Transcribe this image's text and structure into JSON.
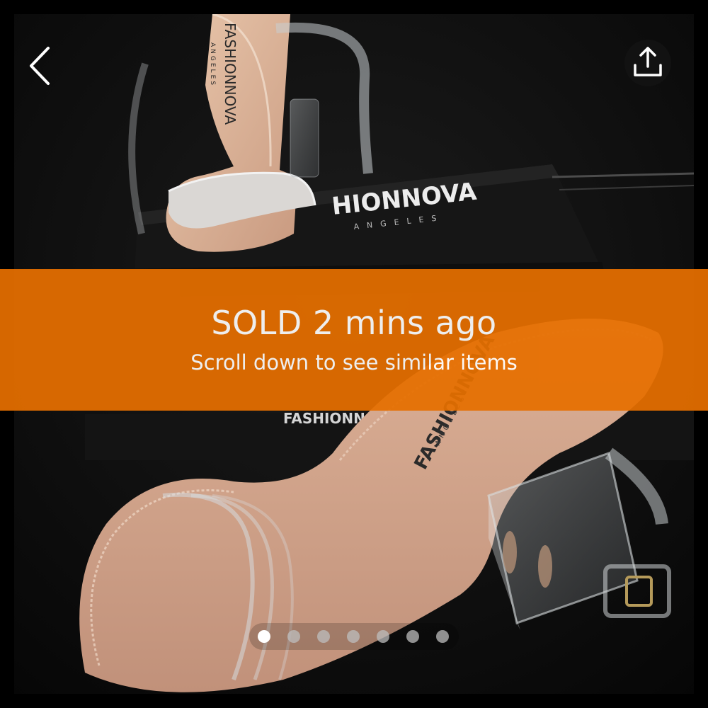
{
  "navigation": {
    "back_icon": "chevron-left-icon",
    "share_icon": "share-upload-icon"
  },
  "photo": {
    "brand_top": "FASHIONNOVA",
    "brand_top_sub": "ANGELES",
    "box_brand_top": "HIONNOVA",
    "box_brand_sub": "ANGELES",
    "box_brand_bottom": "FASHIONNOVA.C",
    "insole_brand": "FASHIONNOVA",
    "insole_sub": "ANGELES"
  },
  "sold_banner": {
    "title": "SOLD 2 mins ago",
    "subtitle": "Scroll down to see similar items",
    "color": "#e66f00"
  },
  "carousel": {
    "total": 7,
    "active_index": 0
  }
}
